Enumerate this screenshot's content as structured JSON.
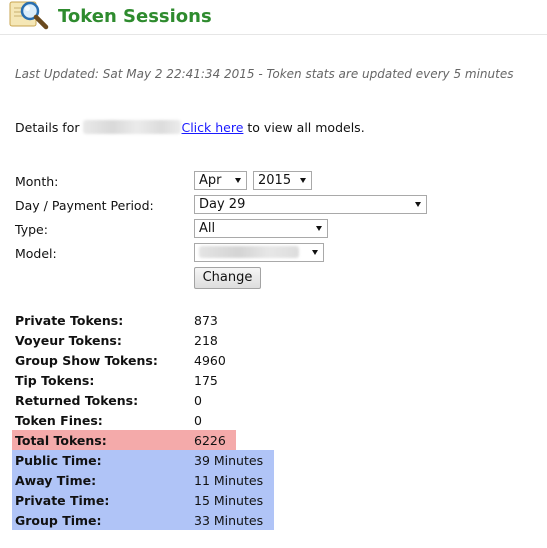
{
  "header": {
    "title": "Token Sessions",
    "logo_icon": "magnifier-on-note-icon"
  },
  "last_updated": "Last Updated: Sat May 2 22:41:34 2015 - Token stats are updated every 5 minutes",
  "details": {
    "prefix": "Details for",
    "link_text": "Click here",
    "suffix": " to view all models."
  },
  "form": {
    "month_label": "Month:",
    "month_value": "Apr",
    "year_value": "2015",
    "day_label": "Day / Payment Period:",
    "day_value": "Day 29",
    "type_label": "Type:",
    "type_value": "All",
    "model_label": "Model:",
    "change_button": "Change"
  },
  "stats": [
    {
      "label": "Private Tokens:",
      "value": "873"
    },
    {
      "label": "Voyeur Tokens:",
      "value": "218"
    },
    {
      "label": "Group Show Tokens:",
      "value": "4960"
    },
    {
      "label": "Tip Tokens:",
      "value": "175"
    },
    {
      "label": "Returned Tokens:",
      "value": "0"
    },
    {
      "label": "Token Fines:",
      "value": "0"
    }
  ],
  "total": {
    "label": "Total Tokens:",
    "value": "6226"
  },
  "times": [
    {
      "label": "Public Time:",
      "value": "39 Minutes"
    },
    {
      "label": "Away Time:",
      "value": "11 Minutes"
    },
    {
      "label": "Private Time:",
      "value": "15 Minutes"
    },
    {
      "label": "Group Time:",
      "value": "33 Minutes"
    }
  ],
  "colors": {
    "title": "#2e8b2e",
    "link": "#1a1aff",
    "total_bg": "#f4aaaa",
    "time_bg": "#b0c4f7"
  }
}
